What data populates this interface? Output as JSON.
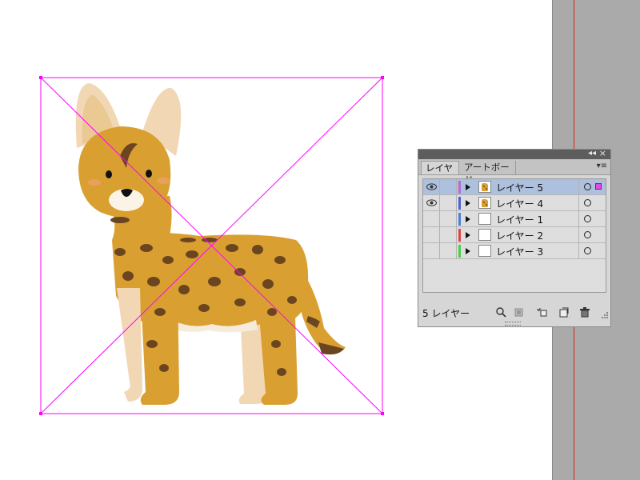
{
  "panel": {
    "tabs": [
      {
        "label": "レイヤー"
      },
      {
        "label": "アートボード"
      }
    ],
    "collapse_glyph": "◂◂",
    "close_glyph": "×",
    "menu_glyph": "▾≡",
    "layers": [
      {
        "name": "レイヤー 5",
        "color": "#b36bd6",
        "visible": true,
        "selected": true
      },
      {
        "name": "レイヤー 4",
        "color": "#4b5fd8",
        "visible": true,
        "selected": false
      },
      {
        "name": "レイヤー 1",
        "color": "#4b7fd8",
        "visible": false,
        "selected": false
      },
      {
        "name": "レイヤー 2",
        "color": "#e04545",
        "visible": false,
        "selected": false
      },
      {
        "name": "レイヤー 3",
        "color": "#45d045",
        "visible": false,
        "selected": false
      }
    ],
    "footer": {
      "layer_count": "5 レイヤー",
      "icons": [
        "locate-object-icon",
        "make-clipping-mask-icon",
        "create-sublayer-icon",
        "new-layer-icon",
        "delete-icon"
      ]
    }
  },
  "artboard": {
    "selection_color": "#ff00ff",
    "image_subject": "serval-cat-illustration"
  },
  "colors": {
    "panel_bg": "#d6d6d6",
    "selected_row": "#adc0dd",
    "pasteboard": "#aaaaaa",
    "guide": "#e0201c"
  }
}
